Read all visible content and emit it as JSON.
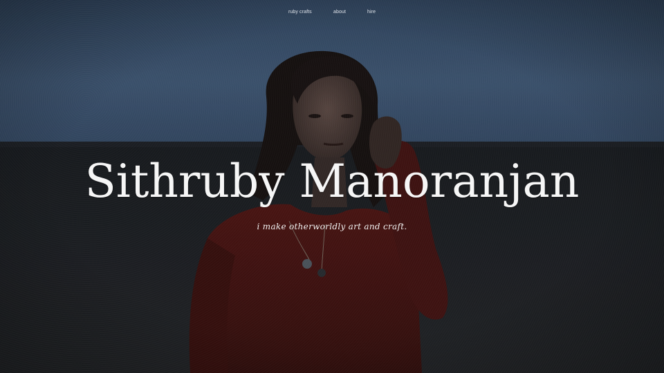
{
  "nav": {
    "items": [
      {
        "label": "ruby crafts"
      },
      {
        "label": "about"
      },
      {
        "label": "hire"
      }
    ]
  },
  "hero": {
    "title": "Sithruby Manoranjan",
    "tagline": "i make otherworldly art and craft.",
    "photo_icon": "portrait-photo"
  },
  "colors": {
    "sky": "#3f5a78",
    "sea": "#1f2226",
    "shirt": "#5a1a16",
    "text": "#f6f6f6"
  }
}
